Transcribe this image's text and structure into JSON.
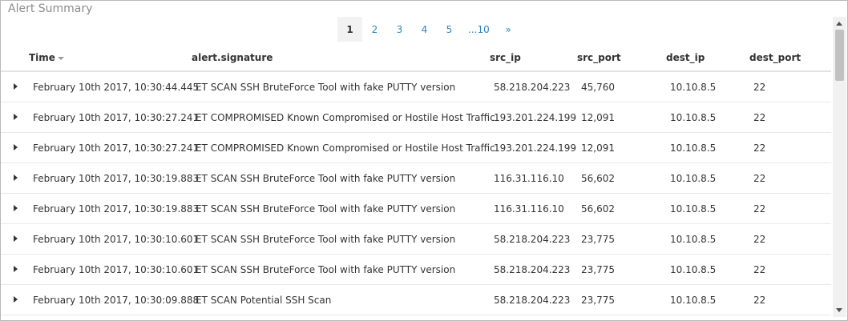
{
  "panel": {
    "title": "Alert Summary"
  },
  "pager": {
    "pages": [
      "1",
      "2",
      "3",
      "4",
      "5",
      "...10",
      "»"
    ],
    "active": "1"
  },
  "table": {
    "columns": [
      "Time",
      "alert.signature",
      "src_ip",
      "src_port",
      "dest_ip",
      "dest_port"
    ],
    "rows": [
      [
        "February 10th 2017, 10:30:44.445",
        "ET SCAN SSH BruteForce Tool with fake PUTTY version",
        "58.218.204.223",
        "45,760",
        "10.10.8.5",
        "22"
      ],
      [
        "February 10th 2017, 10:30:27.241",
        "ET COMPROMISED Known Compromised or Hostile Host Traffic",
        "193.201.224.199",
        "12,091",
        "10.10.8.5",
        "22"
      ],
      [
        "February 10th 2017, 10:30:27.241",
        "ET COMPROMISED Known Compromised or Hostile Host Traffic",
        "193.201.224.199",
        "12,091",
        "10.10.8.5",
        "22"
      ],
      [
        "February 10th 2017, 10:30:19.883",
        "ET SCAN SSH BruteForce Tool with fake PUTTY version",
        "116.31.116.10",
        "56,602",
        "10.10.8.5",
        "22"
      ],
      [
        "February 10th 2017, 10:30:19.883",
        "ET SCAN SSH BruteForce Tool with fake PUTTY version",
        "116.31.116.10",
        "56,602",
        "10.10.8.5",
        "22"
      ],
      [
        "February 10th 2017, 10:30:10.601",
        "ET SCAN SSH BruteForce Tool with fake PUTTY version",
        "58.218.204.223",
        "23,775",
        "10.10.8.5",
        "22"
      ],
      [
        "February 10th 2017, 10:30:10.601",
        "ET SCAN SSH BruteForce Tool with fake PUTTY version",
        "58.218.204.223",
        "23,775",
        "10.10.8.5",
        "22"
      ],
      [
        "February 10th 2017, 10:30:09.888",
        "ET SCAN Potential SSH Scan",
        "58.218.204.223",
        "23,775",
        "10.10.8.5",
        "22"
      ]
    ]
  },
  "colors": {
    "link": "#2e86c1",
    "active_page_bg": "#f2f2f2",
    "border": "#b8b8b8"
  }
}
